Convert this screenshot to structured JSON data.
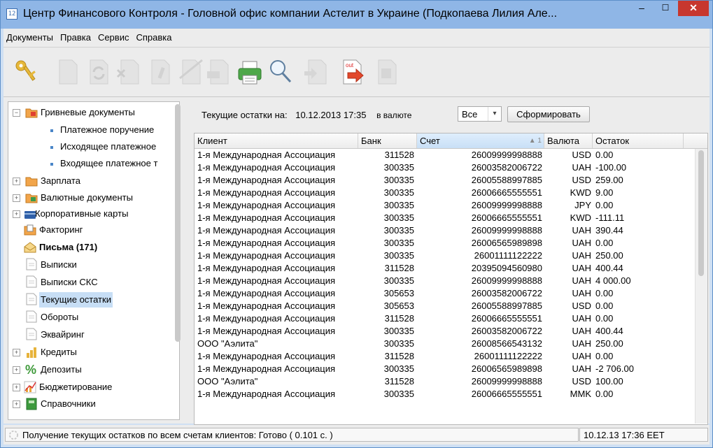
{
  "window": {
    "title": "Центр Финансового Контроля - Головной офис компании Астелит в Украине (Подкопаева Лилия Але...",
    "minimize_glyph": "–",
    "maximize_glyph": "☐",
    "close_glyph": "✕"
  },
  "menu": [
    "Документы",
    "Правка",
    "Сервис",
    "Справка"
  ],
  "toolbar": {
    "icons": [
      "keys-icon",
      "document-icon",
      "refresh-icon",
      "delete-icon",
      "edit-icon",
      "copy-icon",
      "sign-icon",
      "print-icon",
      "search-icon",
      "export-icon",
      "out-arrow-icon",
      "send-icon"
    ],
    "out_label": "out"
  },
  "tree": {
    "hryvnia_docs": "Гривневые документы",
    "payment_order": "Платежное поручение",
    "outgoing_payment": "Исходящее платежное",
    "incoming_payment": "Входящее платежное т",
    "salary": "Зарплата",
    "currency_docs": "Валютные документы",
    "corporate_cards": "Корпоративные карты",
    "factoring": "Факторинг",
    "letters": "Письма (171)",
    "statements": "Выписки",
    "statements_sks": "Выписки СКС",
    "current_balances": "Текущие остатки",
    "turnovers": "Обороты",
    "acquiring": "Эквайринг",
    "credits": "Кредиты",
    "deposits": "Депозиты",
    "budgeting": "Бюджетирование",
    "directories": "Справочники"
  },
  "filter": {
    "label": "Текущие остатки на:",
    "datetime": "10.12.2013 17:35",
    "currency_label": "в валюте",
    "currency_value": "Все",
    "generate_button": "Сформировать"
  },
  "table": {
    "columns": {
      "client": "Клиент",
      "bank": "Банк",
      "account": "Счет",
      "sort_indicator": "▲ 1",
      "currency": "Валюта",
      "balance": "Остаток"
    },
    "rows": [
      [
        "1-я Международная Ассоциация",
        "311528",
        "26009999998888",
        "USD",
        "0.00"
      ],
      [
        "1-я Международная Ассоциация",
        "300335",
        "26003582006722",
        "UAH",
        "-100.00"
      ],
      [
        "1-я Международная Ассоциация",
        "300335",
        "26005588997885",
        "USD",
        "259.00"
      ],
      [
        "1-я Международная Ассоциация",
        "300335",
        "26006665555551",
        "KWD",
        "9.00"
      ],
      [
        "1-я Международная Ассоциация",
        "300335",
        "26009999998888",
        "JPY",
        "0.00"
      ],
      [
        "1-я Международная Ассоциация",
        "300335",
        "26006665555551",
        "KWD",
        "-111.11"
      ],
      [
        "1-я Международная Ассоциация",
        "300335",
        "26009999998888",
        "UAH",
        "390.44"
      ],
      [
        "1-я Международная Ассоциация",
        "300335",
        "26006565989898",
        "UAH",
        "0.00"
      ],
      [
        "1-я Международная Ассоциация",
        "300335",
        "26001111122222",
        "UAH",
        "250.00"
      ],
      [
        "1-я Международная Ассоциация",
        "311528",
        "20395094560980",
        "UAH",
        "400.44"
      ],
      [
        "1-я Международная Ассоциация",
        "300335",
        "26009999998888",
        "UAH",
        "4 000.00"
      ],
      [
        "1-я Международная Ассоциация",
        "305653",
        "26003582006722",
        "UAH",
        "0.00"
      ],
      [
        "1-я Международная Ассоциация",
        "305653",
        "26005588997885",
        "USD",
        "0.00"
      ],
      [
        "1-я Международная Ассоциация",
        "311528",
        "26006665555551",
        "UAH",
        "0.00"
      ],
      [
        "1-я Международная Ассоциация",
        "300335",
        "26003582006722",
        "UAH",
        "400.44"
      ],
      [
        "ООО \"Аэлита\"",
        "300335",
        "26008566543132",
        "UAH",
        "250.00"
      ],
      [
        "1-я Международная Ассоциация",
        "311528",
        "26001111122222",
        "UAH",
        "0.00"
      ],
      [
        "1-я Международная Ассоциация",
        "300335",
        "26006565989898",
        "UAH",
        "-2 706.00"
      ],
      [
        "ООО \"Аэлита\"",
        "311528",
        "26009999998888",
        "USD",
        "100.00"
      ],
      [
        "1-я Международная Ассоциация",
        "300335",
        "26006665555551",
        "MMK",
        "0.00"
      ]
    ]
  },
  "status": {
    "message": "Получение текущих остатков по всем счетам клиентов: Готово ( 0.101 с. )",
    "time": "10.12.13 17:36 EET"
  }
}
